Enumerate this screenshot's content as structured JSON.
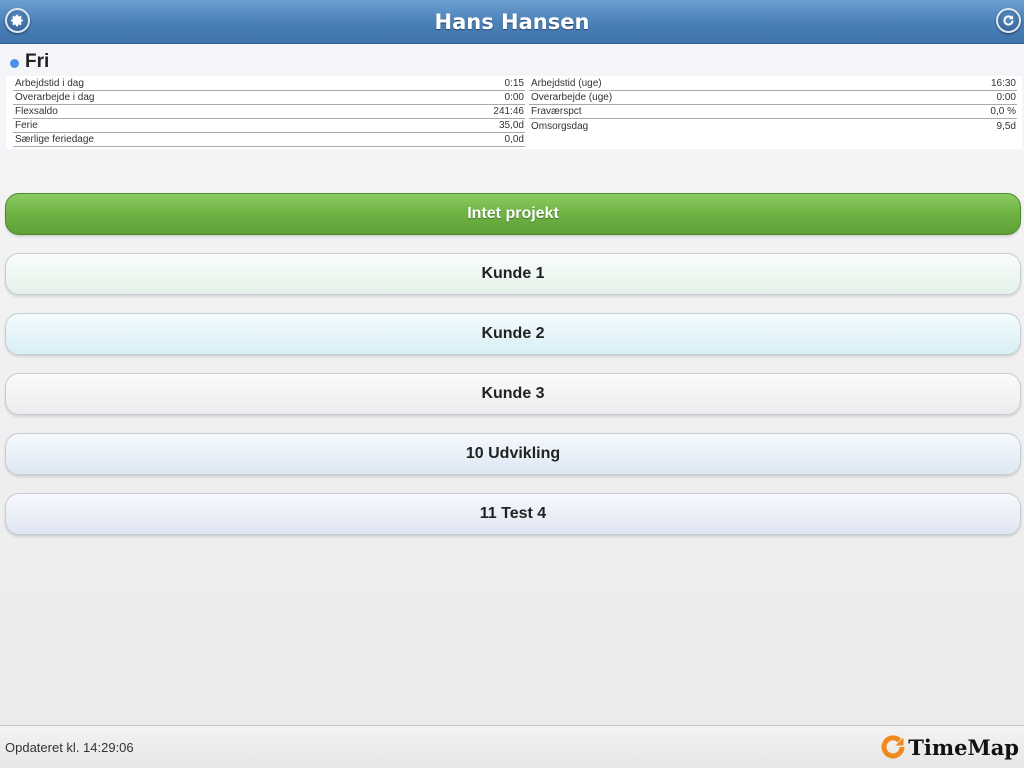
{
  "header": {
    "title": "Hans Hansen",
    "settings_icon": "gear-icon",
    "refresh_icon": "refresh-icon"
  },
  "status": {
    "label": "Fri",
    "dot_color": "#4d8fe8"
  },
  "stats": {
    "left": [
      {
        "label": "Arbejdstid i dag",
        "value": "0:15"
      },
      {
        "label": "Overarbejde i dag",
        "value": "0:00"
      },
      {
        "label": "Flexsaldo",
        "value": "241:46"
      },
      {
        "label": "Ferie",
        "value": "35,0d"
      },
      {
        "label": "Særlige feriedage",
        "value": "0,0d"
      }
    ],
    "right": [
      {
        "label": "Arbejdstid (uge)",
        "value": "16:30"
      },
      {
        "label": "Overarbejde (uge)",
        "value": "0:00"
      },
      {
        "label": "Fraværspct",
        "value": "0,0 %"
      },
      {
        "label": "Omsorgsdag",
        "value": "9,5d"
      }
    ]
  },
  "projects": [
    {
      "label": "Intet projekt"
    },
    {
      "label": "Kunde 1"
    },
    {
      "label": "Kunde 2"
    },
    {
      "label": "Kunde 3"
    },
    {
      "label": "10 Udvikling"
    },
    {
      "label": "11 Test 4"
    }
  ],
  "footer": {
    "updated": "Opdateret kl. 14:29:06",
    "logo_text": "TimeMap",
    "logo_icon": "timemap-logo-icon"
  },
  "colors": {
    "header": "#4a7fb7",
    "active_project": "#6db243"
  }
}
